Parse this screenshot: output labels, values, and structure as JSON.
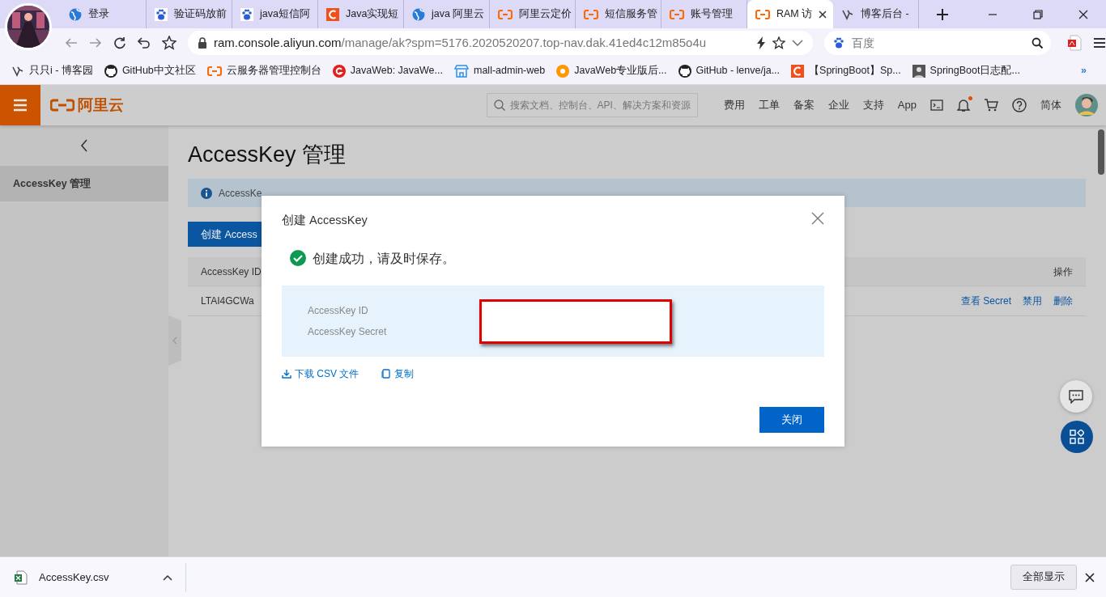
{
  "browser": {
    "tabs": [
      {
        "label": "登录",
        "kind": "globe",
        "selected": false
      },
      {
        "label": "验证码放前",
        "kind": "paw",
        "selected": false
      },
      {
        "label": "java短信阿",
        "kind": "paw",
        "selected": false
      },
      {
        "label": "Java实现短",
        "kind": "letter-c",
        "selected": false
      },
      {
        "label": "java 阿里云",
        "kind": "globe",
        "selected": false
      },
      {
        "label": "阿里云定价",
        "kind": "aliyun",
        "selected": false
      },
      {
        "label": "短信服务管",
        "kind": "aliyun",
        "selected": false
      },
      {
        "label": "账号管理",
        "kind": "aliyun",
        "selected": false
      },
      {
        "label": "RAM 访",
        "kind": "aliyun",
        "selected": true
      },
      {
        "label": "博客后台 -",
        "kind": "bird",
        "selected": false
      }
    ],
    "url_host": "ram.console.aliyun.com",
    "url_path": "/manage/ak?spm=5176.2020520207.top-nav.dak.41ed4c12m85o4u",
    "search": {
      "placeholder": "百度"
    },
    "bookmarks": [
      {
        "label": "只只i - 博客园",
        "kind": "bird"
      },
      {
        "label": "GitHub中文社区",
        "kind": "github"
      },
      {
        "label": "云服务器管理控制台",
        "kind": "aliyun"
      },
      {
        "label": "JavaWeb: JavaWe...",
        "kind": "red-circle"
      },
      {
        "label": "mall-admin-web",
        "kind": "store"
      },
      {
        "label": "JavaWeb专业版后...",
        "kind": "orange-ring"
      },
      {
        "label": "GitHub - lenve/ja...",
        "kind": "github"
      },
      {
        "label": "【SpringBoot】Sp...",
        "kind": "letter-c"
      },
      {
        "label": "SpringBoot日志配..."
      }
    ],
    "bookmarks_more": "»"
  },
  "console": {
    "logo": "阿里云",
    "search_placeholder": "搜索文档、控制台、API、解决方案和资源",
    "nav": [
      "费用",
      "工单",
      "备案",
      "企业",
      "支持",
      "App"
    ],
    "has_unread": true,
    "language": "简体"
  },
  "sidebar": {
    "items": [
      {
        "label": "AccessKey 管理",
        "selected": true
      }
    ]
  },
  "page": {
    "title": "AccessKey 管理",
    "info_text": "AccessKe",
    "create_button": "创建 Access",
    "table": {
      "columns": [
        "AccessKey ID",
        "操作"
      ],
      "rows": [
        {
          "cells": [
            "LTAI4GCWa"
          ],
          "actions": [
            "查看 Secret",
            "禁用",
            "删除"
          ]
        }
      ]
    }
  },
  "dialog": {
    "title": "创建 AccessKey",
    "message": "创建成功，请及时保存。",
    "fields": [
      "AccessKey ID",
      "AccessKey Secret"
    ],
    "links": [
      {
        "label": "下载 CSV 文件",
        "kind": "download"
      },
      {
        "label": "复制",
        "kind": "copy"
      }
    ],
    "button": "关闭"
  },
  "downloads": {
    "file": "AccessKey.csv",
    "show_all": "全部显示"
  }
}
